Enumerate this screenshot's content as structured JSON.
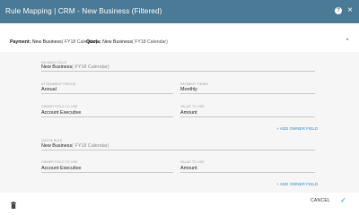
{
  "header": {
    "title": "Rule Mapping | CRM - New Business (Filtered)",
    "help_icon": "?",
    "close_icon": "×"
  },
  "summary": {
    "payment_label": "Payment:",
    "payment_value": "New Business",
    "payment_calendar": "( FY18 Calendar)",
    "quota_label": "Quota:",
    "quota_value": "New Business",
    "quota_calendar": "( FY18 Calendar)"
  },
  "payment_section": {
    "payment_rule_label": "PAYMENT RULE",
    "payment_rule_value": "New Business",
    "payment_rule_calendar": "( FY18 Calendar)",
    "attainment_period_label": "ATTAINMENT PERIOD",
    "attainment_period_value": "Annual",
    "payment_timing_label": "PAYMENT TIMING",
    "payment_timing_value": "Monthly",
    "owner_field_label": "OWNER FIELD TO USE",
    "owner_field_value": "Account Executive",
    "value_field_label": "VALUE TO USE",
    "value_field_value": "Amount",
    "add_owner_field": "+ ADD OWNER FIELD"
  },
  "quota_section": {
    "quota_rule_label": "QUOTA RULE",
    "quota_rule_value": "New Business",
    "quota_rule_calendar": "( FY18 Calendar)",
    "owner_field_label": "OWNER FIELD TO USE",
    "owner_field_value": "Account Executive",
    "value_field_label": "VALUE TO USE",
    "value_field_value": "Amount",
    "add_owner_field": "+ ADD OWNER FIELD"
  },
  "footer": {
    "cancel_label": "CANCEL",
    "confirm_icon": "✓"
  },
  "colors": {
    "header": "#4a7a95",
    "link": "#2f86c6",
    "content_bg": "#f6f6f6"
  }
}
